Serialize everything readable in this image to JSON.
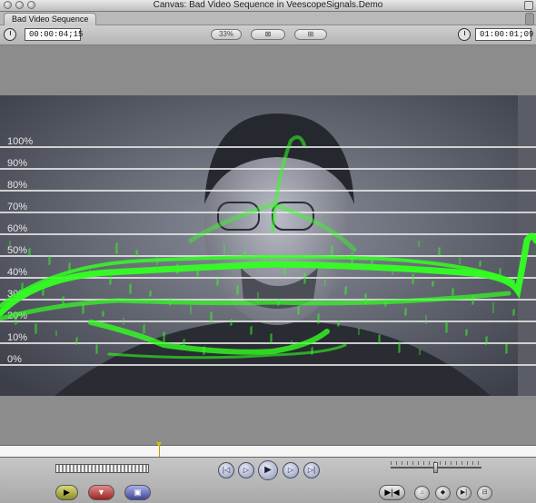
{
  "window": {
    "title": "Canvas: Bad Video Sequence in VeescopeSignals.Demo"
  },
  "tab": {
    "label": "Bad Video Sequence"
  },
  "toolbar": {
    "current_timecode": "00:00:04;15",
    "zoom_label": "33%",
    "view_label": "▾",
    "overlay_label": "▾",
    "end_timecode": "01:00:01;09"
  },
  "waveform": {
    "scale_labels": [
      "100%",
      "90%",
      "80%",
      "70%",
      "60%",
      "50%",
      "40%",
      "30%",
      "20%",
      "10%",
      "0%"
    ],
    "trace_color": "#33ff22"
  },
  "playback": {
    "position_fraction": 0.297
  },
  "icons": {
    "go_prev_edit": "|◁",
    "play_in_out": "▷",
    "play": "▶",
    "play_around": "▷",
    "go_next_edit": "▷|"
  }
}
